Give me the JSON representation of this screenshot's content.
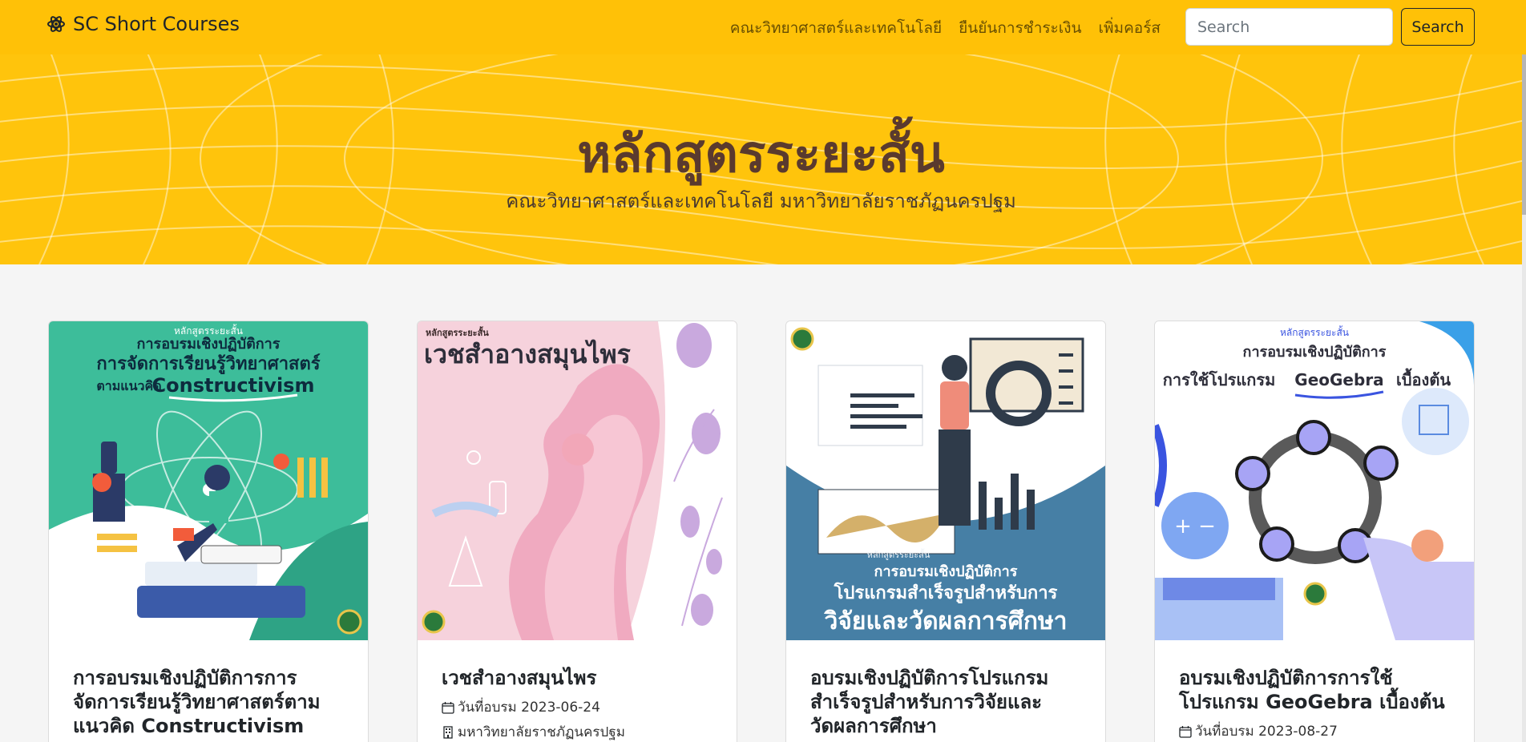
{
  "brand": {
    "name": "SC Short Courses",
    "icon": "atom-icon"
  },
  "nav": {
    "links": [
      "คณะวิทยาศาสตร์และเทคโนโลยี",
      "ยืนยันการชำระเงิน",
      "เพิ่มคอร์ส"
    ]
  },
  "search": {
    "placeholder": "Search",
    "button_label": "Search"
  },
  "hero": {
    "title": "หลักสูตรระยะสั้น",
    "subtitle": "คณะวิทยาศาสตร์และเทคโนโลยี มหาวิทยาลัยราชภัฏนครปฐม"
  },
  "colors": {
    "navbar": "#ffc107",
    "hero": "#ffc40c",
    "title": "#5a3a2e"
  },
  "cards": [
    {
      "title": "การอบรมเชิงปฏิบัติการการจัดการเรียนรู้วิทยาศาสตร์ตามแนวคิด Constructivism",
      "poster": {
        "kicker": "หลักสูตรระยะสั้น",
        "line1": "การอบรมเชิงปฏิบัติการ",
        "line2": "การจัดการเรียนรู้วิทยาศาสตร์",
        "line3": "ตามแนวคิด",
        "line3b": "Constructivism"
      }
    },
    {
      "title": "เวชสำอางสมุนไพร",
      "date_label": "วันที่อบรม 2023-06-24",
      "venue": "มหาวิทยาลัยราชภัฏนครปฐม",
      "poster": {
        "kicker": "หลักสูตรระยะสั้น",
        "headline": "เวชสำอางสมุนไพร"
      }
    },
    {
      "title": "อบรมเชิงปฏิบัติการโปรแกรมสำเร็จรูปสำหรับการวิจัยและวัดผลการศึกษา",
      "poster": {
        "kicker": "หลักสูตรระยะสั้น",
        "line1": "การอบรมเชิงปฏิบัติการ",
        "line2": "โปรแกรมสำเร็จรูปสำหรับการ",
        "line3": "วิจัยและวัดผลการศึกษา"
      }
    },
    {
      "title": "อบรมเชิงปฏิบัติการการใช้โปรแกรม GeoGebra เบื้องต้น",
      "date_label": "วันที่อบรม 2023-08-27",
      "poster": {
        "kicker": "หลักสูตรระยะสั้น",
        "line1": "การอบรมเชิงปฏิบัติการ",
        "line2a": "การใช้โปรแกรม",
        "line2b": "GeoGebra",
        "line2c": "เบื้องต้น"
      }
    }
  ]
}
